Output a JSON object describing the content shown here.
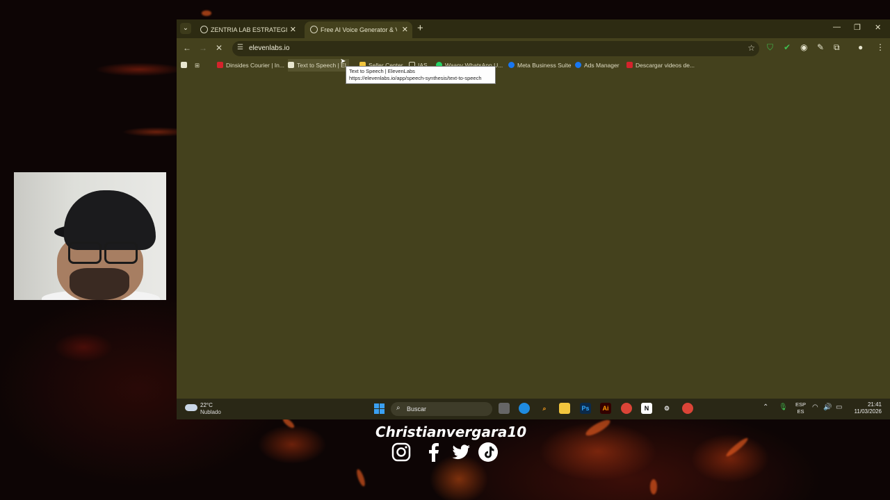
{
  "browser": {
    "tabs": [
      {
        "title": "ZENTRIA LAB ESTRATEGIAS - G"
      },
      {
        "title": "Free AI Voice Generator & Voic"
      }
    ],
    "url": "elevenlabs.io",
    "bookmarks": [
      "Dinsides Courier | In...",
      "Text to Speech | El",
      "Seller Center",
      "IAS",
      "Waapy WhatsApp U...",
      "Meta Business Suite",
      "Ads Manager",
      "Descargar videos de..."
    ],
    "tooltip": {
      "title": "Text to Speech | ElevenLabs",
      "url": "https://elevenlabs.io/app/speech-synthesis/text-to-speech"
    }
  },
  "taskbar": {
    "weather_temp": "22°C",
    "weather_desc": "Nublado",
    "search_label": "Buscar",
    "lang_top": "ESP",
    "lang_bottom": "ES",
    "time": "21:41",
    "date": "11/03/2026"
  },
  "overlay": {
    "handle": "Christianvergara10",
    "social_icons": [
      "instagram-icon",
      "facebook-icon",
      "twitter-icon",
      "tiktok-icon"
    ]
  },
  "colors": {
    "page_bg": "#44411d",
    "tabstrip_bg": "#2d2b12",
    "taskbar_bg": "#2a2816"
  }
}
